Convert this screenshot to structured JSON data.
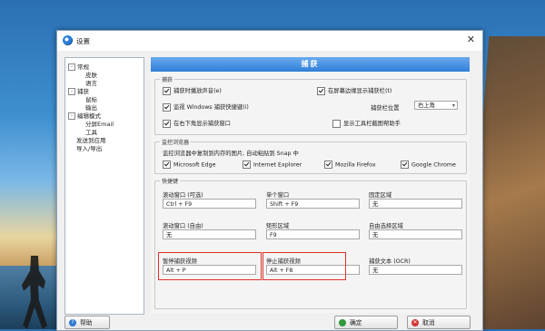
{
  "window": {
    "title": "设置",
    "close_glyph": "✕"
  },
  "tree": [
    {
      "label": "常规",
      "toggle": "-"
    },
    {
      "label": "皮肤"
    },
    {
      "label": "语言"
    },
    {
      "label": "捕获",
      "toggle": "-"
    },
    {
      "label": "鼠标"
    },
    {
      "label": "输出"
    },
    {
      "label": "编辑模式",
      "toggle": "-"
    },
    {
      "label": "分屏Email"
    },
    {
      "label": "工具"
    },
    {
      "label": "发送到应用"
    },
    {
      "label": "导入/导出"
    }
  ],
  "header": {
    "title": "捕获"
  },
  "capture_group": {
    "label": "捕获",
    "play_sound": "捕获时播放声音(e)",
    "show_on_taskbar": "在屏幕边缘显示捕获栏(t)",
    "monitor_windows_hotkeys": "监视 Windows 捕获快捷键(i)",
    "bar_position_label": "捕获栏位置",
    "bar_position_value": "右上角",
    "show_bottom_right": "在右下角显示捕获窗口",
    "show_toolbar_hint": "显示工具栏截图帮助手"
  },
  "browser_group": {
    "label": "监控浏览器",
    "desc": "监控浏览器中复制到内存的图片, 自动粘贴到 Snap 中",
    "browsers": [
      "Microsoft Edge",
      "Internet Explorer",
      "Mozilla Firefox",
      "Google Chrome"
    ]
  },
  "hotkey_group": {
    "label": "快捷键",
    "fields": [
      {
        "label": "滚动窗口 (可选)",
        "value": "Ctrl + F9"
      },
      {
        "label": "单个窗口",
        "value": "Shift + F9"
      },
      {
        "label": "固定区域",
        "value": "无"
      },
      {
        "label": "滚动窗口 (自由)",
        "value": "无"
      },
      {
        "label": "矩形区域",
        "value": "F9"
      },
      {
        "label": "自由选择区域",
        "value": "无"
      },
      {
        "label": "暂停捕获视频",
        "value": "Alt + P"
      },
      {
        "label": "停止捕获视频",
        "value": "Alt + F8"
      },
      {
        "label": "捕获文本 (OCR)",
        "value": "无"
      }
    ]
  },
  "buttons": {
    "help": "帮助",
    "ok": "确定",
    "cancel": "取消"
  },
  "colors": {
    "header": "#2f7fd6",
    "highlight": "#e0302a"
  }
}
